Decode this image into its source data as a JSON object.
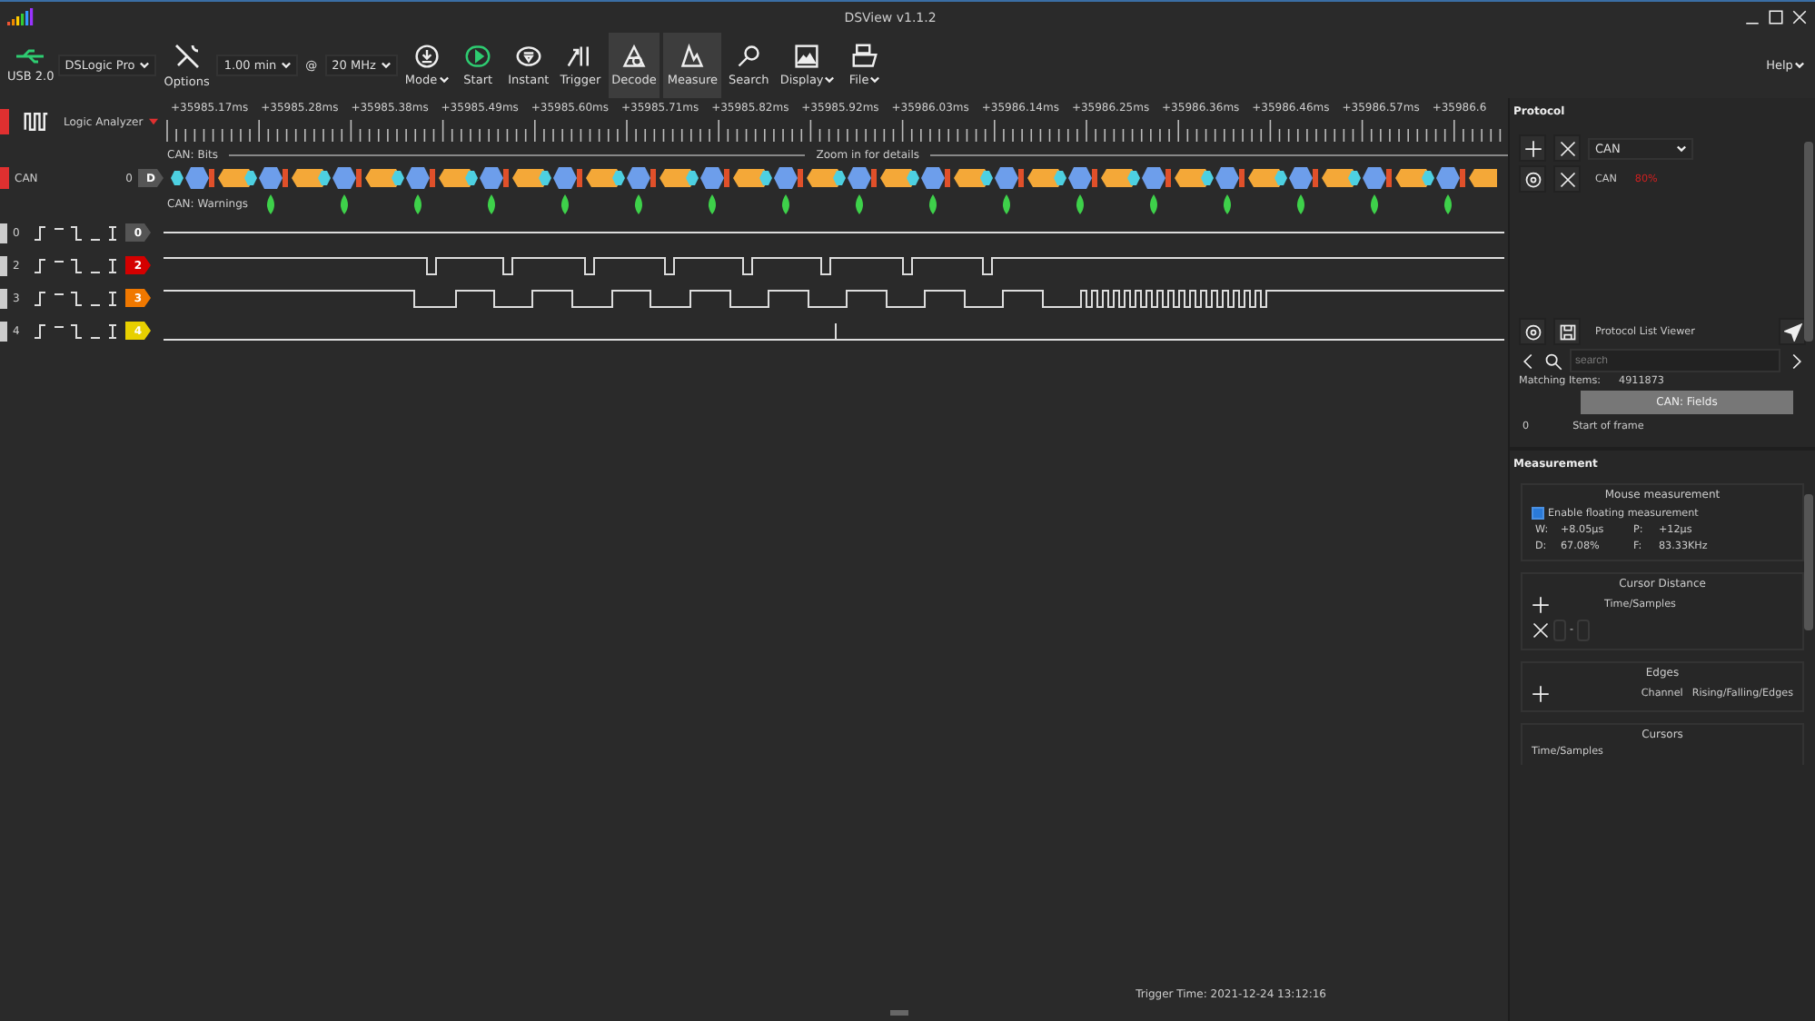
{
  "window": {
    "title": "DSView v1.1.2"
  },
  "toolbar": {
    "interface": "USB 2.0",
    "device": "DSLogic Pro",
    "options": "Options",
    "duration": "1.00 min",
    "at": "@",
    "rate": "20 MHz",
    "buttons": [
      {
        "kind": "mode",
        "label": "Mode",
        "menu": true,
        "selected": false
      },
      {
        "kind": "start",
        "label": "Start",
        "menu": false,
        "selected": false
      },
      {
        "kind": "instant",
        "label": "Instant",
        "menu": false,
        "selected": false
      },
      {
        "kind": "trigger",
        "label": "Trigger",
        "menu": false,
        "selected": false
      },
      {
        "kind": "decode",
        "label": "Decode",
        "menu": false,
        "selected": true
      },
      {
        "kind": "measure",
        "label": "Measure",
        "menu": false,
        "selected": true
      },
      {
        "kind": "search",
        "label": "Search",
        "menu": false,
        "selected": false
      },
      {
        "kind": "display",
        "label": "Display",
        "menu": true,
        "selected": false
      },
      {
        "kind": "file",
        "label": "File",
        "menu": true,
        "selected": false
      }
    ],
    "help": "Help"
  },
  "ruler": {
    "mode": "Logic Analyzer",
    "labels": [
      "+35985.17ms",
      "+35985.28ms",
      "+35985.38ms",
      "+35985.49ms",
      "+35985.60ms",
      "+35985.71ms",
      "+35985.82ms",
      "+35985.92ms",
      "+35986.03ms",
      "+35986.14ms",
      "+35986.25ms",
      "+35986.36ms",
      "+35986.46ms",
      "+35986.57ms",
      "+35986.6"
    ]
  },
  "decoder": {
    "name": "CAN",
    "index": "0",
    "badge": "D",
    "rows": [
      "CAN: Bits",
      "CAN: Warnings"
    ],
    "hint": "Zoom in for details"
  },
  "channels": [
    {
      "number": "0",
      "badge": "0",
      "color": "#555555"
    },
    {
      "number": "2",
      "badge": "2",
      "color": "#d40000"
    },
    {
      "number": "3",
      "badge": "3",
      "color": "#f07800"
    },
    {
      "number": "4",
      "badge": "4",
      "color": "#e8d000"
    }
  ],
  "trigger_time": "Trigger Time: 2021-12-24 13:12:16",
  "protocol": {
    "title": "Protocol",
    "selector": "CAN",
    "decoders": [
      {
        "name": "CAN",
        "progress": "80%",
        "complete": false
      }
    ],
    "list_viewer": {
      "title": "Protocol List Viewer",
      "search_placeholder": "search",
      "matching_label": "Matching Items:",
      "matching_count": "4911873",
      "column": "CAN: Fields",
      "rows": [
        {
          "index": "0",
          "value": "Start of frame"
        }
      ]
    }
  },
  "measurement": {
    "title": "Measurement",
    "mouse": {
      "title": "Mouse measurement",
      "floating": {
        "label": "Enable floating measurement",
        "checked": true
      },
      "readings": [
        {
          "label": "W:",
          "value": "+8.05µs"
        },
        {
          "label": "P:",
          "value": "+12µs"
        },
        {
          "label": "D:",
          "value": "67.08%"
        },
        {
          "label": "F:",
          "value": "83.33KHz"
        }
      ]
    },
    "cursor_distance": {
      "title": "Cursor Distance",
      "column": "Time/Samples",
      "separator": "-"
    },
    "edges": {
      "title": "Edges",
      "columns": [
        "Channel",
        "Rising/Falling/Edges"
      ]
    },
    "cursors": {
      "title": "Cursors",
      "column": "Time/Samples"
    }
  }
}
